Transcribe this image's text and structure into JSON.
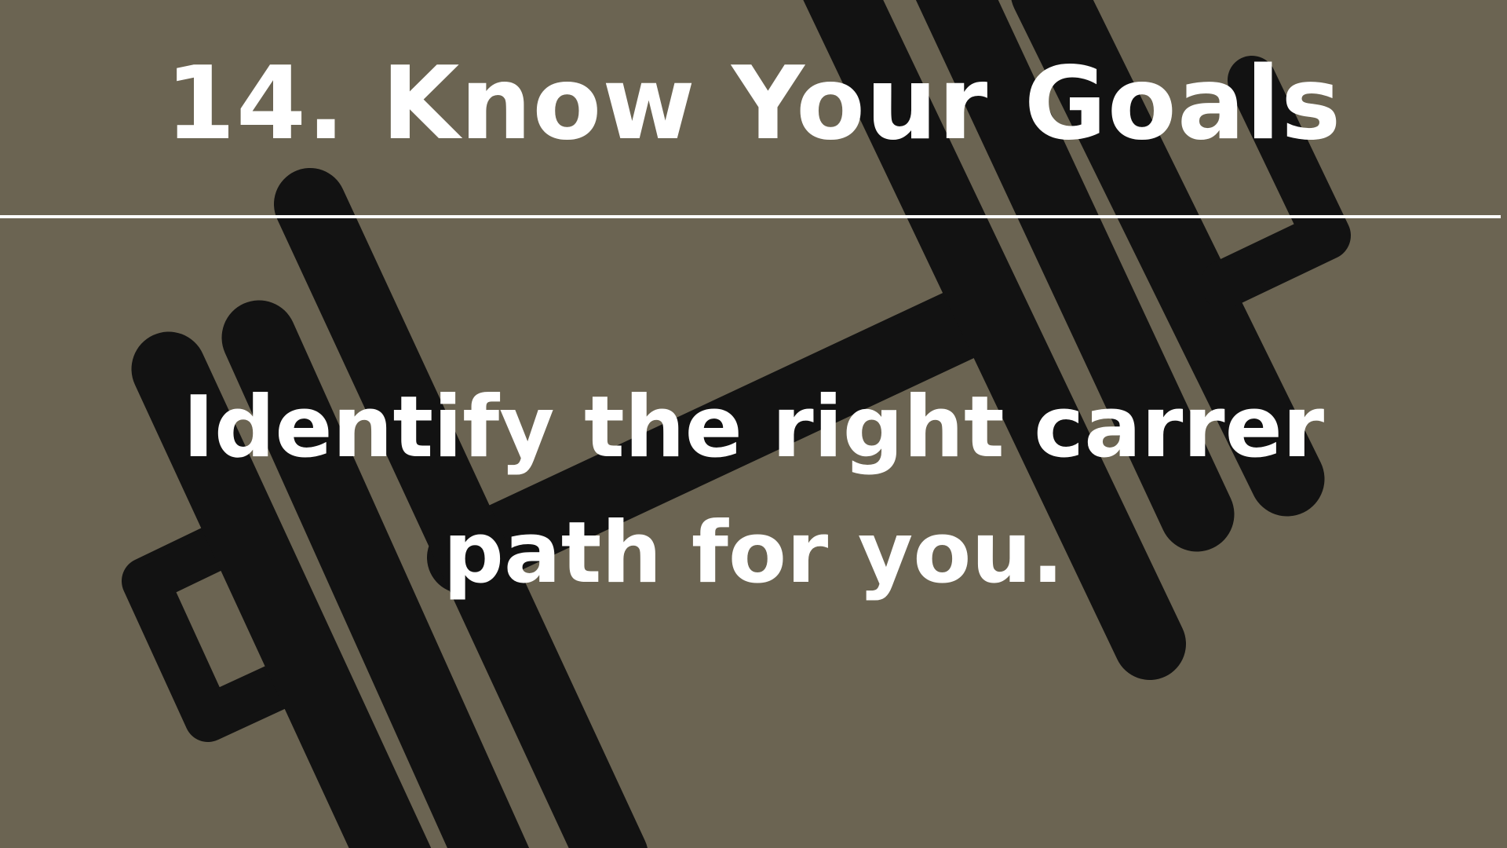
{
  "slide": {
    "title": "14. Know Your Goals",
    "body_lines": [
      "Identify the right carrer",
      "path for you."
    ]
  },
  "colors": {
    "background": "#6b6452",
    "art": "#121212",
    "text": "#ffffff"
  },
  "icons": {
    "background_art": "dumbbell-icon"
  }
}
